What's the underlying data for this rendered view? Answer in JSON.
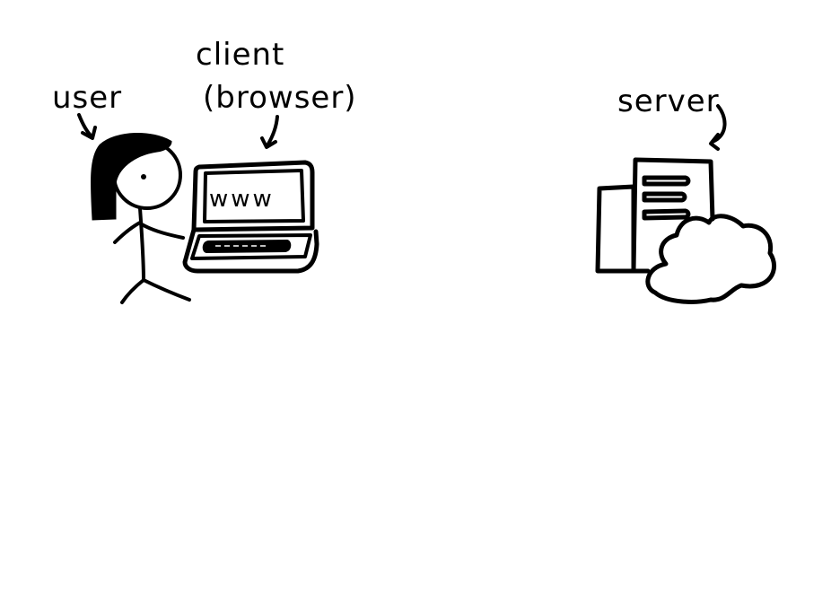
{
  "labels": {
    "user": "user",
    "client": "client",
    "browser": "(browser)",
    "server": "server",
    "screen": "www"
  },
  "colors": {
    "ink": "#000000",
    "paper": "#ffffff"
  },
  "icons": {
    "user": "stick-figure-user-icon",
    "client": "laptop-icon",
    "server": "server-building-icon",
    "cloud": "cloud-icon"
  }
}
